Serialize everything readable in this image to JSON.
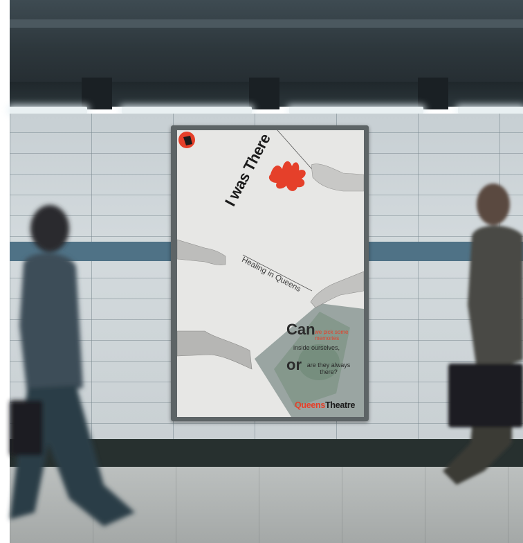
{
  "poster": {
    "title_prefix": "I was ",
    "title_emphasis": "There",
    "subtitle": "Healing in Queens",
    "question_can": "Can",
    "question_red": "we pick some memories",
    "question_inside": "inside ourselves,",
    "question_or": "or",
    "question_always": "are they always there?",
    "brand_part1": "Queens",
    "brand_part2": "Theatre",
    "accent_color": "#e5402a",
    "logo_icon": "queens-theatre-logo"
  }
}
